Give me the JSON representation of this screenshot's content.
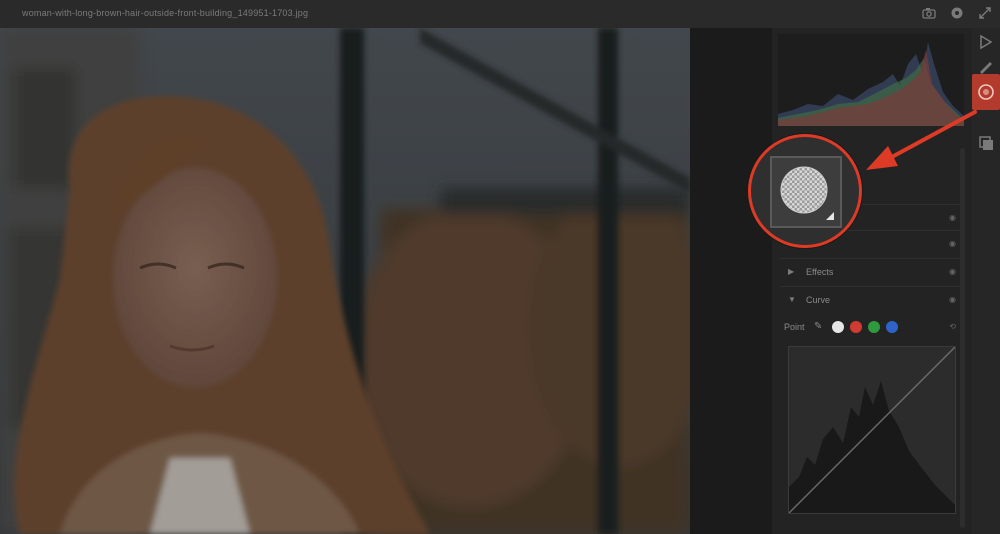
{
  "window": {
    "title": "woman-with-long-brown-hair-outside-front-building_149951-1703.jpg"
  },
  "toolstrip": {
    "items": [
      {
        "name": "edit-tool",
        "active": false
      },
      {
        "name": "brush-tool",
        "active": false
      },
      {
        "name": "radial-gradient-tool",
        "active": true
      },
      {
        "name": "presets-tool",
        "active": false
      }
    ]
  },
  "panel": {
    "sections": [
      {
        "label": "",
        "collapsed": true
      },
      {
        "label": "",
        "collapsed": true
      },
      {
        "label": "Effects",
        "collapsed": true
      },
      {
        "label": "Curve",
        "collapsed": false
      }
    ],
    "curve": {
      "channel_label": "Point",
      "channel_colors": [
        "#e6e6e6",
        "#d23b33",
        "#2f9a3d",
        "#2f63c9"
      ]
    }
  },
  "accent_color": "#dd3b26"
}
